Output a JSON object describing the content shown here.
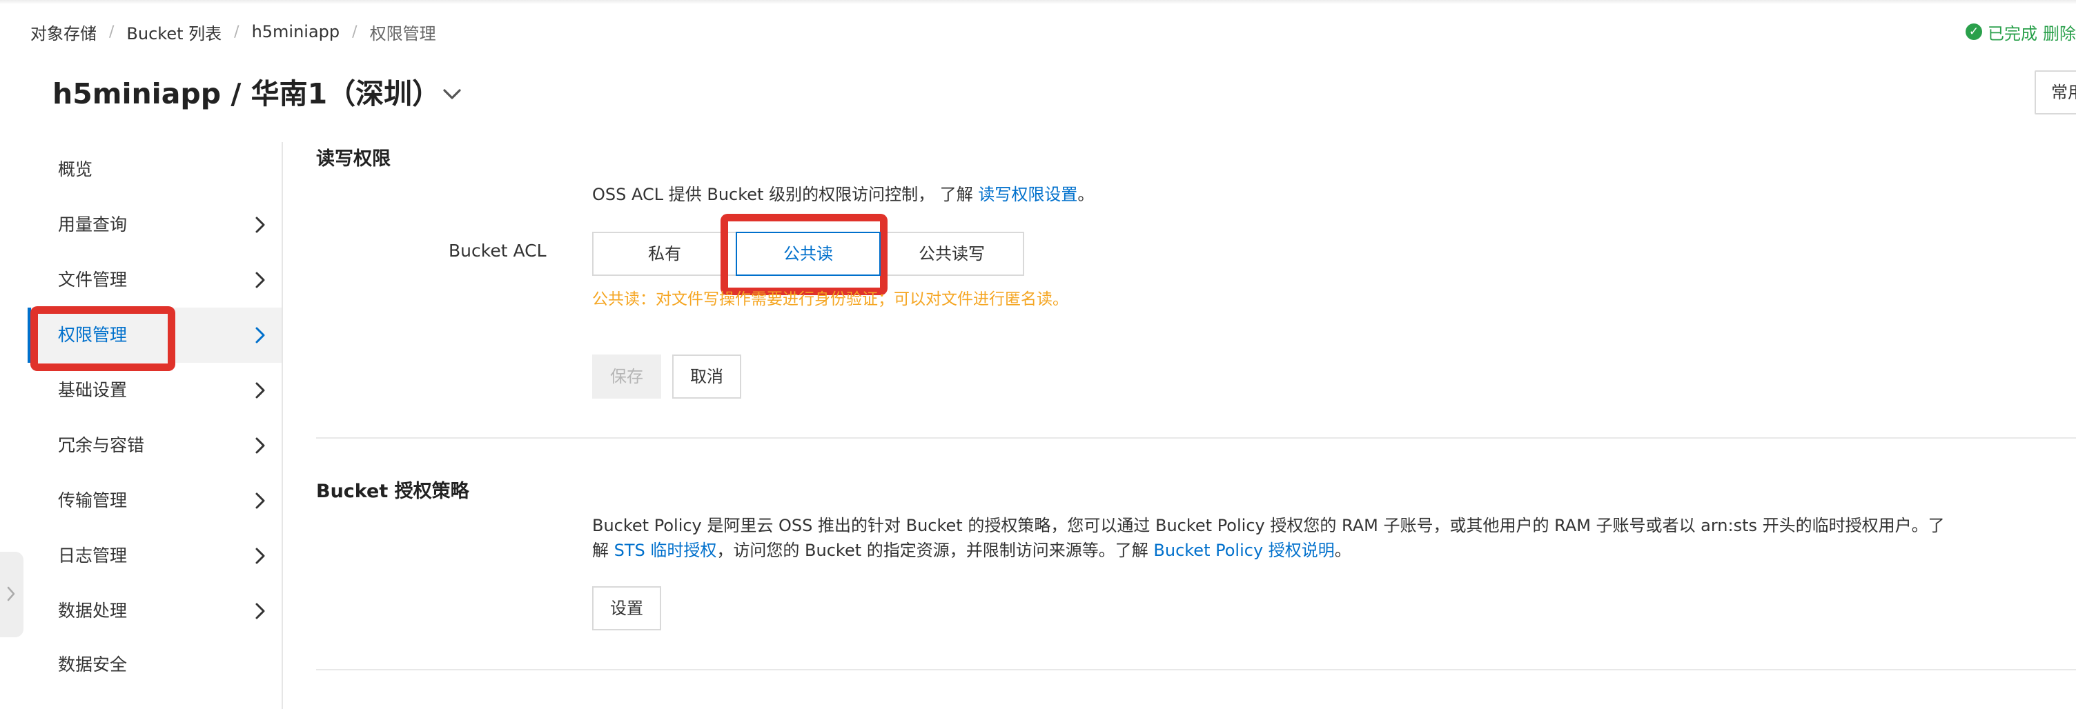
{
  "breadcrumb": {
    "items": [
      "对象存储",
      "Bucket 列表",
      "h5miniapp",
      "权限管理"
    ],
    "separator": "/"
  },
  "header": {
    "title": "h5miniapp / 华南1（深圳）",
    "status_text": "已完成",
    "status_extra": "删除",
    "right_button_label": "常用"
  },
  "sidebar": {
    "items": [
      {
        "label": "概览",
        "has_arrow": false
      },
      {
        "label": "用量查询",
        "has_arrow": true
      },
      {
        "label": "文件管理",
        "has_arrow": true
      },
      {
        "label": "权限管理",
        "has_arrow": true,
        "active": true
      },
      {
        "label": "基础设置",
        "has_arrow": true
      },
      {
        "label": "冗余与容错",
        "has_arrow": true
      },
      {
        "label": "传输管理",
        "has_arrow": true
      },
      {
        "label": "日志管理",
        "has_arrow": true
      },
      {
        "label": "数据处理",
        "has_arrow": true
      },
      {
        "label": "数据安全",
        "has_arrow": false
      }
    ]
  },
  "acl_section": {
    "title": "读写权限",
    "desc_prefix": "OSS ACL 提供 Bucket 级别的权限访问控制， 了解 ",
    "desc_link": "读写权限设置",
    "desc_suffix": "。",
    "label": "Bucket ACL",
    "options": [
      "私有",
      "公共读",
      "公共读写"
    ],
    "selected": "公共读",
    "hint": "公共读：对文件写操作需要进行身份验证；可以对文件进行匿名读。",
    "save_label": "保存",
    "cancel_label": "取消"
  },
  "policy_section": {
    "title": "Bucket 授权策略",
    "line1": "Bucket Policy 是阿里云 OSS 推出的针对 Bucket 的授权策略，您可以通过 Bucket Policy 授权您的 RAM 子账号，或其他用户的 RAM 子账号或者以 arn:sts 开头的临时授权用户。了",
    "line2_prefix": "解 ",
    "line2_link1": "STS 临时授权",
    "line2_middle": "，访问您的 Bucket 的指定资源，并限制访问来源等。了解 ",
    "line2_link2": "Bucket Policy 授权说明",
    "line2_suffix": "。",
    "settings_label": "设置"
  },
  "colors": {
    "accent": "#0070cc",
    "warning": "#f5a623",
    "success": "#2aa04b",
    "annotation": "#e0322a"
  }
}
